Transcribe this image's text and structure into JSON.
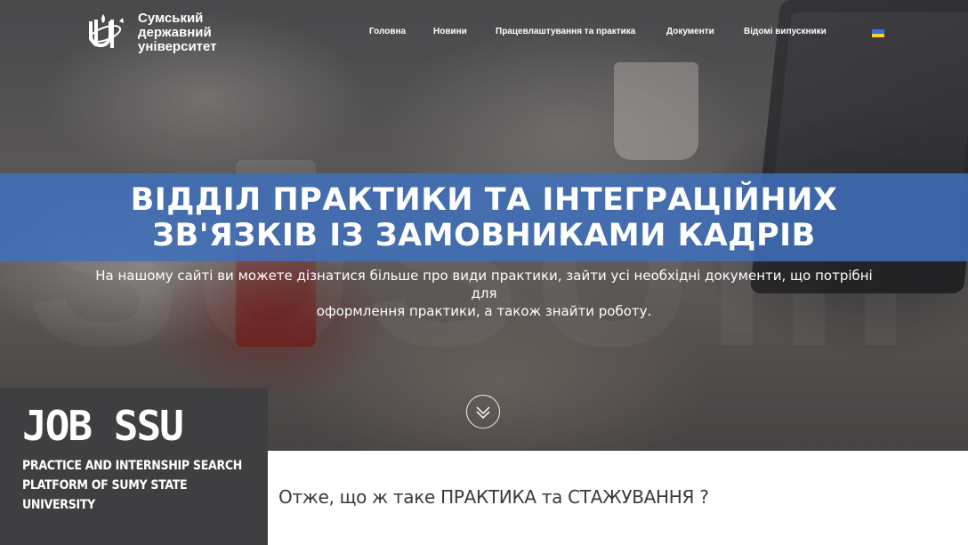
{
  "header": {
    "logo_lines": [
      "Сумський",
      "державний",
      "університет"
    ],
    "nav": [
      "Головна",
      "Новини",
      "Працевлаштування та практика",
      "Документи",
      "Відомі випускники"
    ],
    "flag_colors": {
      "top": "#3a6fd8",
      "bottom": "#f3d02c"
    }
  },
  "hero": {
    "title_line1": "ВІДДІЛ ПРАКТИКИ ТА ІНТЕГРАЦІЙНИХ",
    "title_line2": "ЗВ'ЯЗКІВ ІЗ ЗАМОВНИКАМИ КАДРІВ",
    "subtitle_line1": "На нашому сайті ви можете дізнатися більше про види практики, зайти усі необхідні документи, що потрібні для",
    "subtitle_line2": "оформлення практики, а також знайти роботу.",
    "banner_color": "#3e70bc",
    "scroll_icon": "chevron-down-icon"
  },
  "job_box": {
    "title": "JOB SSU",
    "subtitle_lines": [
      "PRACTICE AND INTERNSHIP SEARCH",
      "PLATFORM OF SUMY STATE",
      "UNIVERSITY"
    ]
  },
  "content": {
    "question_prefix": "Отже, що ж таке ",
    "question_word1": "ПРАКТИКА",
    "question_mid": " та ",
    "question_word2": "СТАЖУВАННЯ",
    "question_suffix": " ?"
  }
}
